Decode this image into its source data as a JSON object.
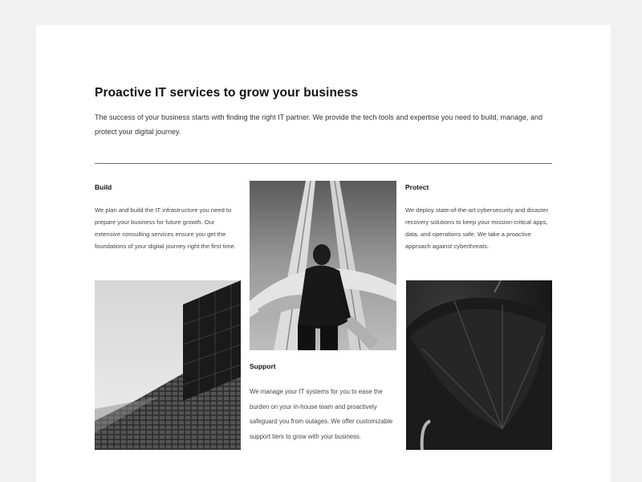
{
  "section": {
    "headline": "Proactive IT services to grow your business",
    "intro": "The success of your business starts with finding the right IT partner. We provide the tech tools and expertise you need to build, manage, and protect your digital journey."
  },
  "columns": {
    "build": {
      "title": "Build",
      "text": "We plan and build the IT infrastructure you need to prepare your business for future growth. Our extensive consulting services ensure you get the foundations of your digital journey right the first time."
    },
    "support": {
      "title": "Support",
      "text": "We manage your IT systems for you to ease the burden on your in-house team and proactively safeguard you from outages. We offer customizable support tiers to grow with your business."
    },
    "protect": {
      "title": "Protect",
      "text": "We deploy state-of-the-art cybersecurity and disaster recovery solutions to keep your mission-critical apps, data, and operations safe. We take a proactive approach against cyberthreats."
    }
  }
}
